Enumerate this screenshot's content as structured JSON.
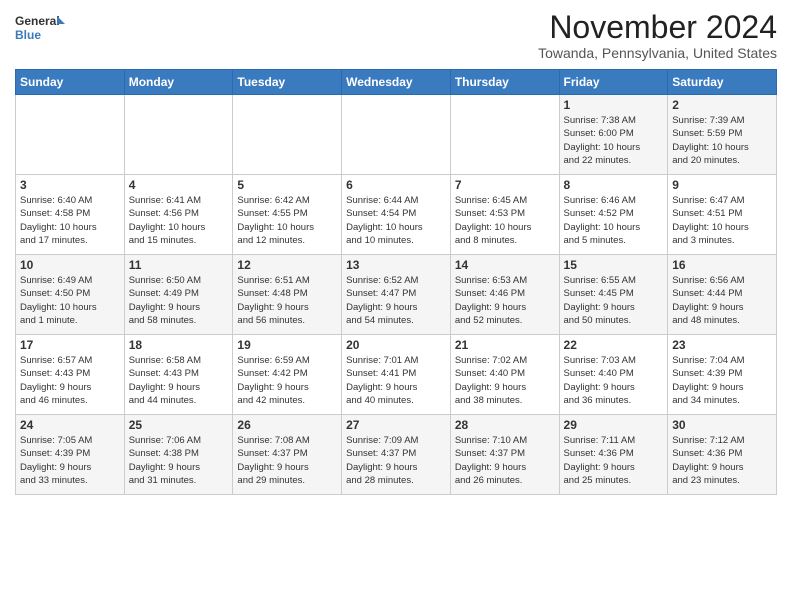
{
  "header": {
    "logo_line1": "General",
    "logo_line2": "Blue",
    "month": "November 2024",
    "location": "Towanda, Pennsylvania, United States"
  },
  "days_of_week": [
    "Sunday",
    "Monday",
    "Tuesday",
    "Wednesday",
    "Thursday",
    "Friday",
    "Saturday"
  ],
  "weeks": [
    [
      {
        "day": "",
        "info": ""
      },
      {
        "day": "",
        "info": ""
      },
      {
        "day": "",
        "info": ""
      },
      {
        "day": "",
        "info": ""
      },
      {
        "day": "",
        "info": ""
      },
      {
        "day": "1",
        "info": "Sunrise: 7:38 AM\nSunset: 6:00 PM\nDaylight: 10 hours\nand 22 minutes."
      },
      {
        "day": "2",
        "info": "Sunrise: 7:39 AM\nSunset: 5:59 PM\nDaylight: 10 hours\nand 20 minutes."
      }
    ],
    [
      {
        "day": "3",
        "info": "Sunrise: 6:40 AM\nSunset: 4:58 PM\nDaylight: 10 hours\nand 17 minutes."
      },
      {
        "day": "4",
        "info": "Sunrise: 6:41 AM\nSunset: 4:56 PM\nDaylight: 10 hours\nand 15 minutes."
      },
      {
        "day": "5",
        "info": "Sunrise: 6:42 AM\nSunset: 4:55 PM\nDaylight: 10 hours\nand 12 minutes."
      },
      {
        "day": "6",
        "info": "Sunrise: 6:44 AM\nSunset: 4:54 PM\nDaylight: 10 hours\nand 10 minutes."
      },
      {
        "day": "7",
        "info": "Sunrise: 6:45 AM\nSunset: 4:53 PM\nDaylight: 10 hours\nand 8 minutes."
      },
      {
        "day": "8",
        "info": "Sunrise: 6:46 AM\nSunset: 4:52 PM\nDaylight: 10 hours\nand 5 minutes."
      },
      {
        "day": "9",
        "info": "Sunrise: 6:47 AM\nSunset: 4:51 PM\nDaylight: 10 hours\nand 3 minutes."
      }
    ],
    [
      {
        "day": "10",
        "info": "Sunrise: 6:49 AM\nSunset: 4:50 PM\nDaylight: 10 hours\nand 1 minute."
      },
      {
        "day": "11",
        "info": "Sunrise: 6:50 AM\nSunset: 4:49 PM\nDaylight: 9 hours\nand 58 minutes."
      },
      {
        "day": "12",
        "info": "Sunrise: 6:51 AM\nSunset: 4:48 PM\nDaylight: 9 hours\nand 56 minutes."
      },
      {
        "day": "13",
        "info": "Sunrise: 6:52 AM\nSunset: 4:47 PM\nDaylight: 9 hours\nand 54 minutes."
      },
      {
        "day": "14",
        "info": "Sunrise: 6:53 AM\nSunset: 4:46 PM\nDaylight: 9 hours\nand 52 minutes."
      },
      {
        "day": "15",
        "info": "Sunrise: 6:55 AM\nSunset: 4:45 PM\nDaylight: 9 hours\nand 50 minutes."
      },
      {
        "day": "16",
        "info": "Sunrise: 6:56 AM\nSunset: 4:44 PM\nDaylight: 9 hours\nand 48 minutes."
      }
    ],
    [
      {
        "day": "17",
        "info": "Sunrise: 6:57 AM\nSunset: 4:43 PM\nDaylight: 9 hours\nand 46 minutes."
      },
      {
        "day": "18",
        "info": "Sunrise: 6:58 AM\nSunset: 4:43 PM\nDaylight: 9 hours\nand 44 minutes."
      },
      {
        "day": "19",
        "info": "Sunrise: 6:59 AM\nSunset: 4:42 PM\nDaylight: 9 hours\nand 42 minutes."
      },
      {
        "day": "20",
        "info": "Sunrise: 7:01 AM\nSunset: 4:41 PM\nDaylight: 9 hours\nand 40 minutes."
      },
      {
        "day": "21",
        "info": "Sunrise: 7:02 AM\nSunset: 4:40 PM\nDaylight: 9 hours\nand 38 minutes."
      },
      {
        "day": "22",
        "info": "Sunrise: 7:03 AM\nSunset: 4:40 PM\nDaylight: 9 hours\nand 36 minutes."
      },
      {
        "day": "23",
        "info": "Sunrise: 7:04 AM\nSunset: 4:39 PM\nDaylight: 9 hours\nand 34 minutes."
      }
    ],
    [
      {
        "day": "24",
        "info": "Sunrise: 7:05 AM\nSunset: 4:39 PM\nDaylight: 9 hours\nand 33 minutes."
      },
      {
        "day": "25",
        "info": "Sunrise: 7:06 AM\nSunset: 4:38 PM\nDaylight: 9 hours\nand 31 minutes."
      },
      {
        "day": "26",
        "info": "Sunrise: 7:08 AM\nSunset: 4:37 PM\nDaylight: 9 hours\nand 29 minutes."
      },
      {
        "day": "27",
        "info": "Sunrise: 7:09 AM\nSunset: 4:37 PM\nDaylight: 9 hours\nand 28 minutes."
      },
      {
        "day": "28",
        "info": "Sunrise: 7:10 AM\nSunset: 4:37 PM\nDaylight: 9 hours\nand 26 minutes."
      },
      {
        "day": "29",
        "info": "Sunrise: 7:11 AM\nSunset: 4:36 PM\nDaylight: 9 hours\nand 25 minutes."
      },
      {
        "day": "30",
        "info": "Sunrise: 7:12 AM\nSunset: 4:36 PM\nDaylight: 9 hours\nand 23 minutes."
      }
    ]
  ]
}
